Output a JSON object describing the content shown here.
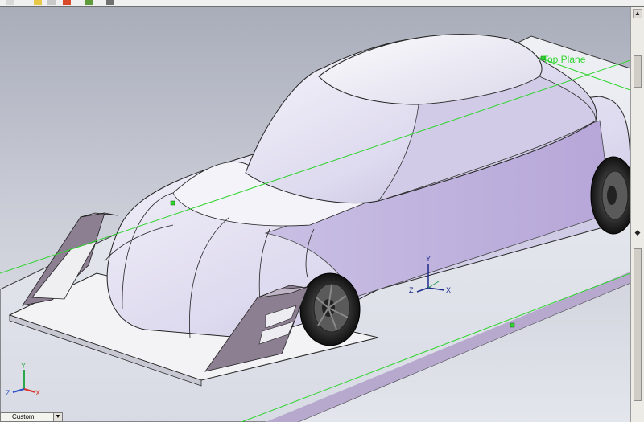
{
  "viewport": {
    "plane_label": "Top Plane"
  },
  "triad_model": {
    "x": "X",
    "y": "Y",
    "z": "Z"
  },
  "triad_corner": {
    "x": "X",
    "y": "Y",
    "z": "Z"
  },
  "config": {
    "value": "Custom"
  },
  "colors": {
    "plane_green": "#2fd42f",
    "body": "#e4e1f3",
    "spoiler": "#8d7f92"
  }
}
